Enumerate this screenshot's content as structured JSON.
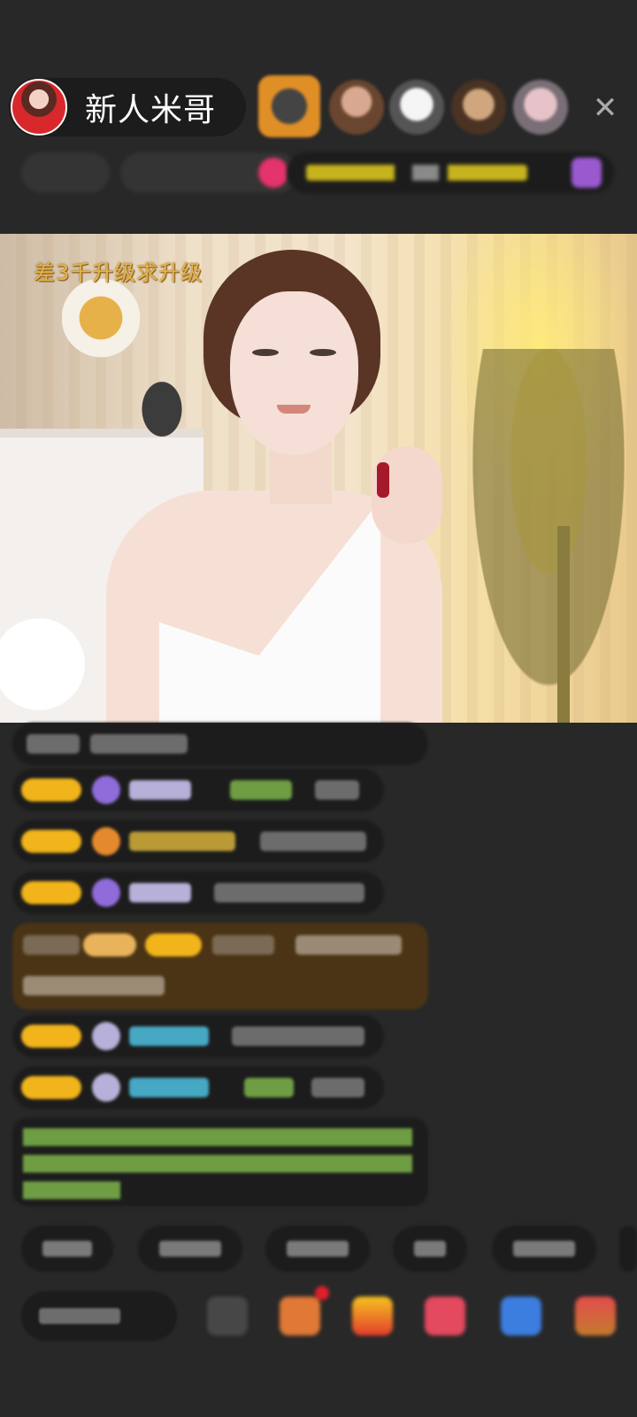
{
  "header": {
    "host_name": "新人米哥",
    "close_symbol": "✕",
    "viewers": [
      "viewer-1",
      "viewer-2",
      "viewer-3",
      "viewer-4",
      "viewer-5"
    ]
  },
  "video": {
    "overlay_text": "差3千升级求升级"
  },
  "colors": {
    "background": "#282828",
    "pill": "#1c1c1c",
    "badge_gold": "#f1b41a",
    "overlay_text": "#e7b34a",
    "gift_highlight": "#5a3a14"
  },
  "icons": {
    "close": "close-icon",
    "diamond": "diamond-icon",
    "gift": "gift-icon",
    "chat_tools": [
      "emoji-icon",
      "gift-box-icon",
      "red-packet-icon",
      "game-icon",
      "message-icon",
      "more-icon"
    ]
  }
}
